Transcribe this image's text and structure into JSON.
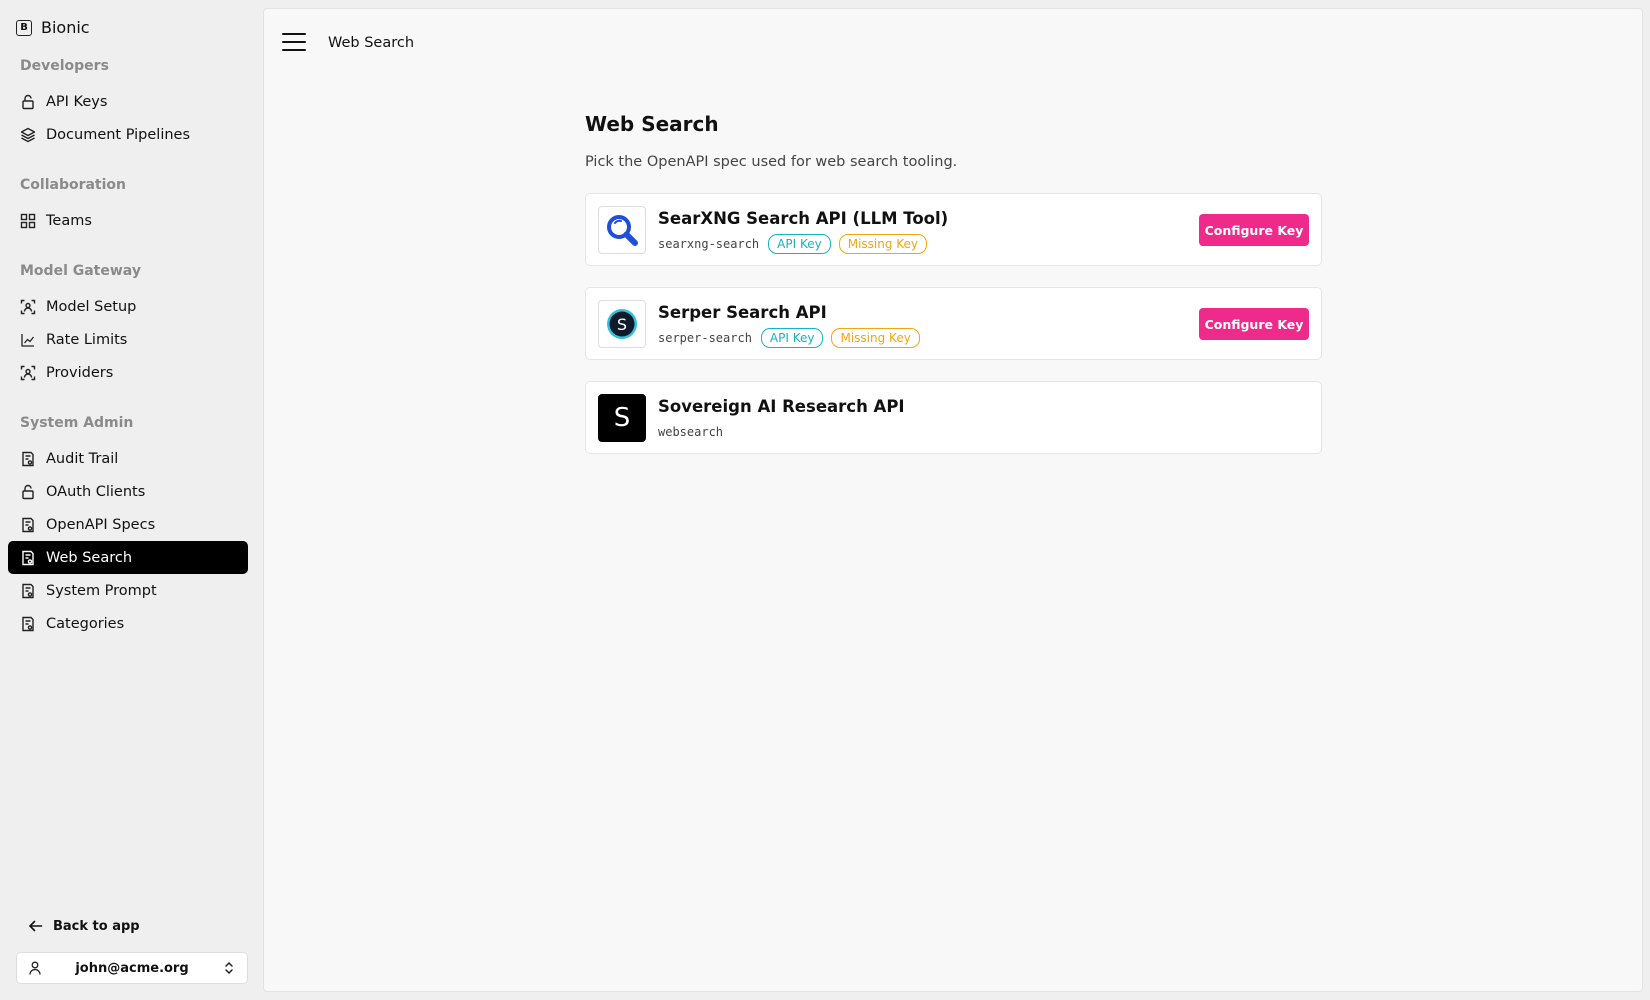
{
  "brand": {
    "logo_letter": "B",
    "name": "Bionic"
  },
  "sidebar": {
    "sections": [
      {
        "title": "Developers",
        "items": [
          {
            "label": "API Keys",
            "icon": "lock-icon"
          },
          {
            "label": "Document Pipelines",
            "icon": "layers-icon"
          }
        ]
      },
      {
        "title": "Collaboration",
        "items": [
          {
            "label": "Teams",
            "icon": "grid-icon"
          }
        ]
      },
      {
        "title": "Model Gateway",
        "items": [
          {
            "label": "Model Setup",
            "icon": "scan-icon"
          },
          {
            "label": "Rate Limits",
            "icon": "chart-icon"
          },
          {
            "label": "Providers",
            "icon": "scan-icon"
          }
        ]
      },
      {
        "title": "System Admin",
        "items": [
          {
            "label": "Audit Trail",
            "icon": "document-icon"
          },
          {
            "label": "OAuth Clients",
            "icon": "lock-icon"
          },
          {
            "label": "OpenAPI Specs",
            "icon": "document-icon"
          },
          {
            "label": "Web Search",
            "icon": "document-icon",
            "active": true
          },
          {
            "label": "System Prompt",
            "icon": "document-icon"
          },
          {
            "label": "Categories",
            "icon": "document-icon"
          }
        ]
      }
    ],
    "back_label": "Back to app",
    "user_email": "john@acme.org"
  },
  "header": {
    "breadcrumb": "Web Search"
  },
  "main": {
    "title": "Web Search",
    "subtitle": "Pick the OpenAPI spec used for web search tooling.",
    "cards": [
      {
        "name": "SearXNG Search API (LLM Tool)",
        "slug": "searxng-search",
        "badges": [
          "API Key",
          "Missing Key"
        ],
        "button": "Configure Key",
        "logo": "magnifier-logo"
      },
      {
        "name": "Serper Search API",
        "slug": "serper-search",
        "badges": [
          "API Key",
          "Missing Key"
        ],
        "button": "Configure Key",
        "logo": "serper-logo",
        "logo_letter": "S"
      },
      {
        "name": "Sovereign AI Research API",
        "slug": "websearch",
        "badges": [],
        "logo": "sovereign-logo",
        "logo_letter": "S"
      }
    ]
  },
  "colors": {
    "accent": "#ee2b8a",
    "info": "#16b3c4",
    "warning": "#f2a510",
    "active_bg": "#000000"
  }
}
